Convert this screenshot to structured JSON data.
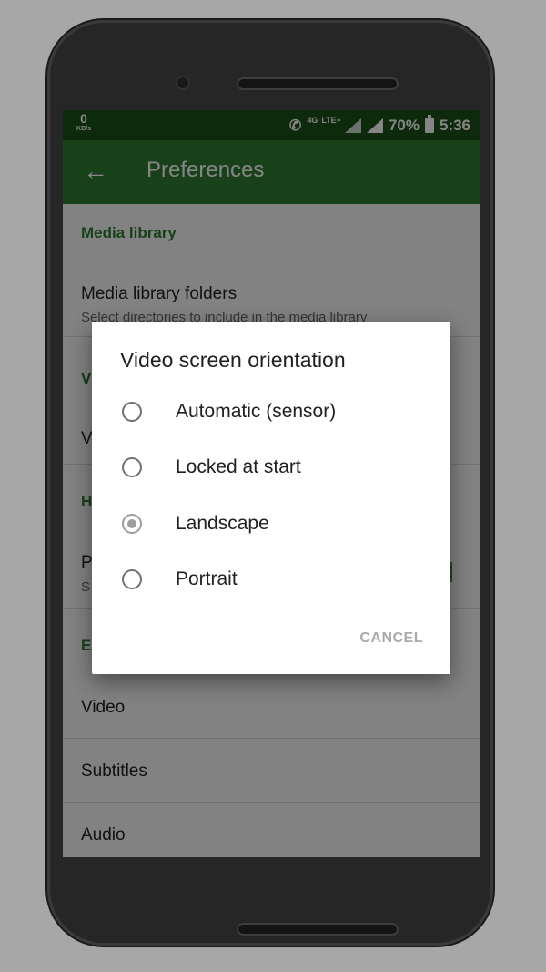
{
  "statusbar": {
    "net_speed": "0",
    "net_unit": "KB/s",
    "network_badge": "4G",
    "lte": "LTE+",
    "battery": "70%",
    "time": "5:36"
  },
  "toolbar": {
    "title": "Preferences"
  },
  "settings": {
    "media_header": "Media library",
    "media_folders_title": "Media library folders",
    "media_folders_sub": "Select directories to include in the media library",
    "partial_v": "V",
    "partial_h": "H",
    "partial_p": "P",
    "partial_s": "S",
    "partial_e": "E",
    "video": "Video",
    "subtitles": "Subtitles",
    "audio": "Audio"
  },
  "dialog": {
    "title": "Video screen orientation",
    "options": [
      "Automatic (sensor)",
      "Locked at start",
      "Landscape",
      "Portrait"
    ],
    "selected": "Landscape",
    "cancel": "CANCEL"
  },
  "icons": {
    "back": "arrow-left-icon",
    "radio_checked": "radio-checked-icon",
    "radio_unchecked": "radio-unchecked-icon"
  },
  "colors": {
    "accent": "#2e7d32",
    "statusbar": "#1a5417"
  }
}
